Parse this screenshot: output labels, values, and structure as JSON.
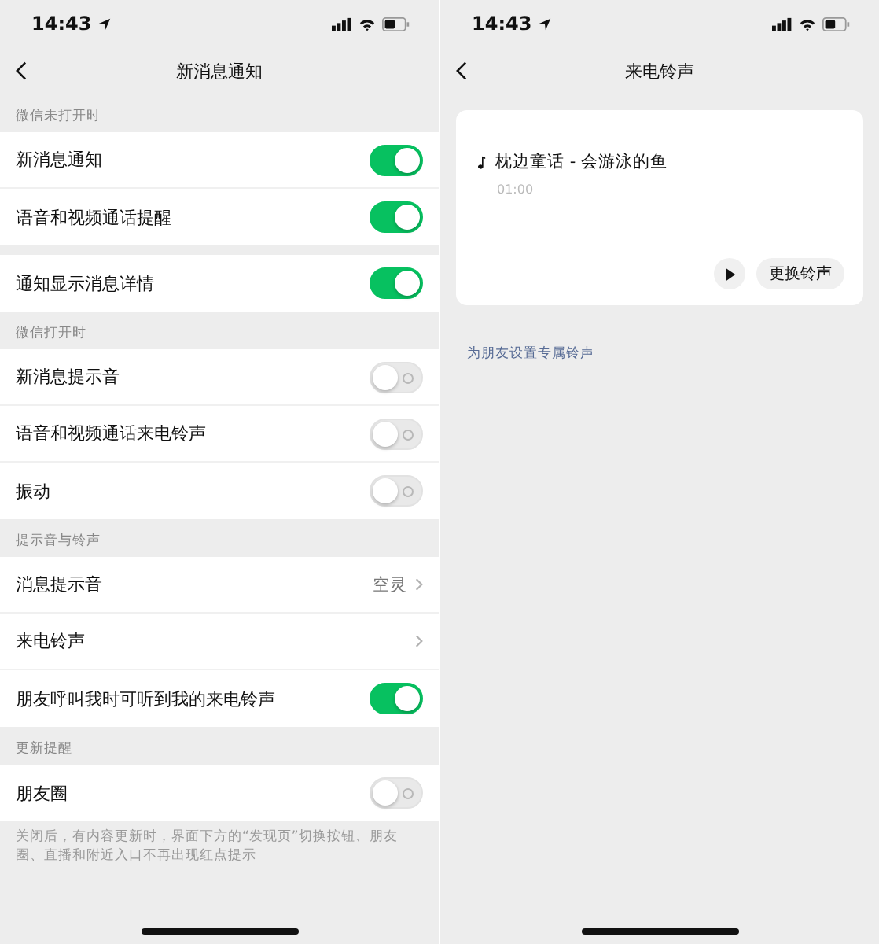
{
  "settings_screen": {
    "status_bar": {
      "time": "14:43"
    },
    "title": "新消息通知",
    "groups": [
      {
        "header": "微信未打开时",
        "rows": [
          {
            "kind": "toggle",
            "label": "新消息通知",
            "on": true
          },
          {
            "kind": "toggle",
            "label": "语音和视频通话提醒",
            "on": true
          }
        ]
      },
      {
        "rows": [
          {
            "kind": "toggle",
            "label": "通知显示消息详情",
            "on": true
          }
        ]
      },
      {
        "header": "微信打开时",
        "rows": [
          {
            "kind": "toggle",
            "label": "新消息提示音",
            "on": false
          },
          {
            "kind": "toggle",
            "label": "语音和视频通话来电铃声",
            "on": false
          },
          {
            "kind": "toggle",
            "label": "振动",
            "on": false
          }
        ]
      },
      {
        "header": "提示音与铃声",
        "rows": [
          {
            "kind": "link",
            "label": "消息提示音",
            "value": "空灵"
          },
          {
            "kind": "link",
            "label": "来电铃声"
          },
          {
            "kind": "toggle",
            "label": "朋友呼叫我时可听到我的来电铃声",
            "on": true
          }
        ]
      },
      {
        "header": "更新提醒",
        "rows": [
          {
            "kind": "toggle",
            "label": "朋友圈",
            "on": false
          }
        ]
      }
    ],
    "footnote": "关闭后，有内容更新时，界面下方的“发现页”切换按钮、朋友圈、直播和附近入口不再出现红点提示"
  },
  "ringtone_screen": {
    "status_bar": {
      "time": "14:43"
    },
    "title": "来电铃声",
    "ringtone": {
      "song": "枕边童话 - 会游泳的鱼",
      "duration": "01:00",
      "change_button": "更换铃声"
    },
    "friend_link": "为朋友设置专属铃声"
  }
}
